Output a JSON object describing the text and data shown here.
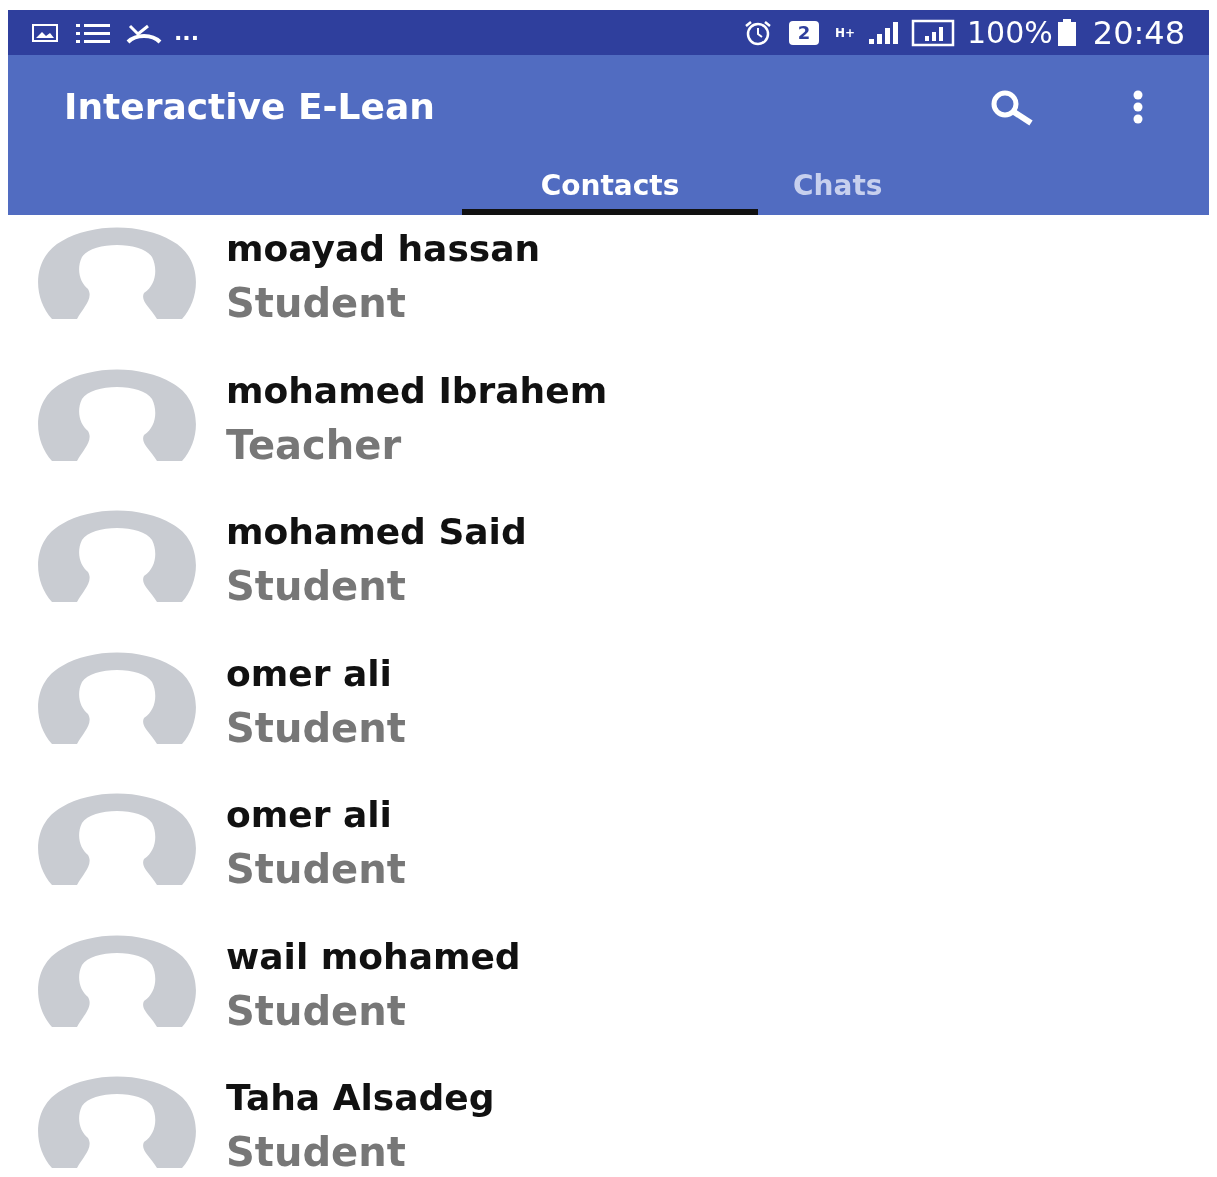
{
  "status_bar": {
    "overflow": "...",
    "sim_badge": "2",
    "network": "H+",
    "battery": "100%",
    "time": "20:48"
  },
  "app_bar": {
    "title": "Interactive E-Lean"
  },
  "tabs": [
    {
      "label": "Contacts",
      "selected": true
    },
    {
      "label": "Chats",
      "selected": false
    }
  ],
  "contacts": [
    {
      "name": "moayad hassan",
      "role": "Student"
    },
    {
      "name": "mohamed Ibrahem",
      "role": "Teacher"
    },
    {
      "name": "mohamed Said",
      "role": "Student"
    },
    {
      "name": "omer ali",
      "role": "Student"
    },
    {
      "name": "omer ali",
      "role": "Student"
    },
    {
      "name": "wail mohamed",
      "role": "Student"
    },
    {
      "name": "Taha Alsadeg",
      "role": "Student"
    }
  ]
}
